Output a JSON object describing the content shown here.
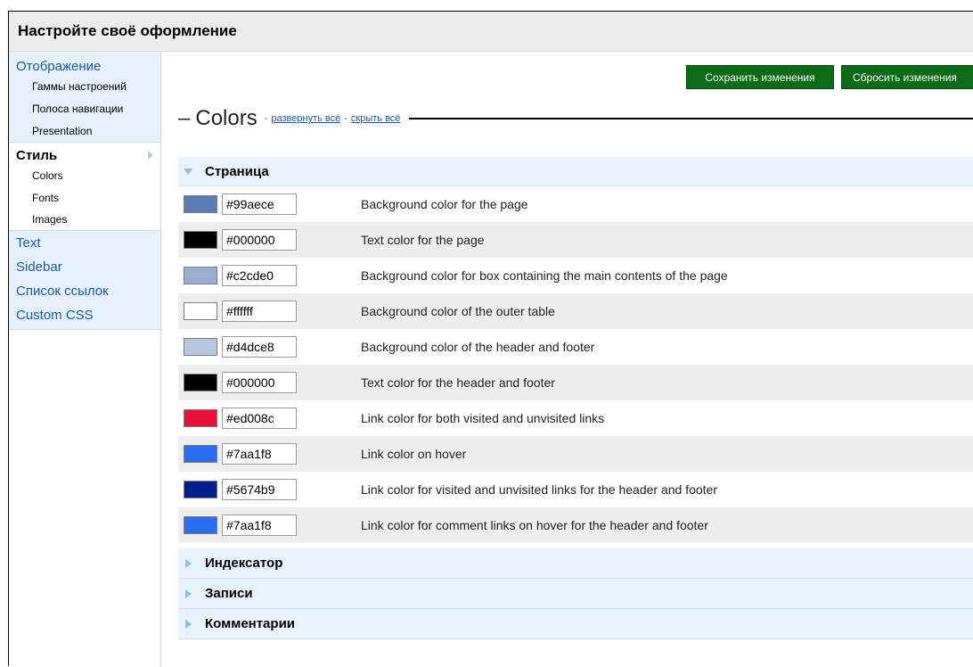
{
  "title": "Настройте своё оформление",
  "sidebar": {
    "display_head": "Отображение",
    "display_items": [
      "Гаммы настроений",
      "Полоса навигации",
      "Presentation"
    ],
    "style_head": "Стиль",
    "style_items": [
      "Colors",
      "Fonts",
      "Images"
    ],
    "other_items": [
      "Text",
      "Sidebar",
      "Список ссылок",
      "Custom CSS"
    ]
  },
  "buttons": {
    "save": "Сохранить изменения",
    "reset": "Сбросить изменения"
  },
  "legend": {
    "dash": "–",
    "title": "Colors",
    "sep1": "-",
    "expand_all": "развернуть всё",
    "sep2": "-",
    "collapse_all": "скрыть всё"
  },
  "sections": {
    "page": "Страница",
    "indexer": "Индексатор",
    "entries": "Записи",
    "comments": "Комментарии"
  },
  "colors": [
    {
      "hex": "#99aece",
      "swatch": "#5a7bb4",
      "desc": "Background color for the page"
    },
    {
      "hex": "#000000",
      "swatch": "#000000",
      "desc": "Text color for the page"
    },
    {
      "hex": "#c2cde0",
      "swatch": "#9aaed2",
      "desc": "Background color for box containing the main contents of the page"
    },
    {
      "hex": "#ffffff",
      "swatch": "#ffffff",
      "desc": "Background color of the outer table"
    },
    {
      "hex": "#d4dce8",
      "swatch": "#b8c6dd",
      "desc": "Background color of the header and footer"
    },
    {
      "hex": "#000000",
      "swatch": "#000000",
      "desc": "Text color for the header and footer"
    },
    {
      "hex": "#ed008c",
      "swatch": "#e8103a",
      "desc": "Link color for both visited and unvisited links"
    },
    {
      "hex": "#7aa1f8",
      "swatch": "#2a6cf2",
      "desc": "Link color on hover"
    },
    {
      "hex": "#5674b9",
      "swatch": "#001e8c",
      "desc": "Link color for visited and unvisited links for the header and footer"
    },
    {
      "hex": "#7aa1f8",
      "swatch": "#2a6cf2",
      "desc": "Link color for comment links on hover for the header and footer"
    }
  ]
}
